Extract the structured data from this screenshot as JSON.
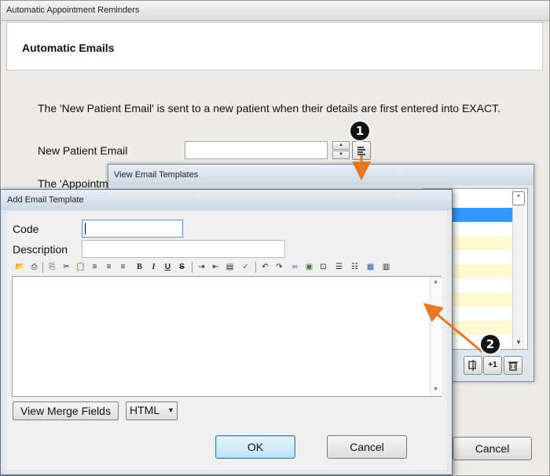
{
  "main_window": {
    "title": "Automatic Appointment Reminders",
    "heading": "Automatic Emails",
    "description": "The 'New Patient Email' is sent to a new patient when their details are first entered into EXACT.",
    "new_patient_email_label": "New Patient Email",
    "new_patient_email_value": "",
    "appointment_label": "The 'Appointm",
    "cancel_label": "Cancel"
  },
  "callouts": {
    "one": "1",
    "two": "2"
  },
  "view_templates_window": {
    "title": "View Email Templates",
    "add_button_label": "+1"
  },
  "add_template_window": {
    "title": "Add Email Template",
    "code_label": "Code",
    "code_value": "",
    "description_label": "Description",
    "description_value": "",
    "view_merge_fields_label": "View Merge Fields",
    "format_selected": "HTML",
    "ok_label": "OK",
    "cancel_label": "Cancel"
  },
  "colors": {
    "selected_row": "#3399ff",
    "alt_row": "#fff9d2",
    "arrow": "#e87722"
  }
}
